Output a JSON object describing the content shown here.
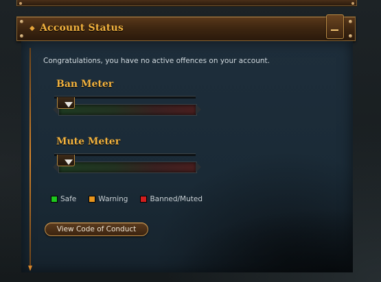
{
  "panel": {
    "title": "Account Status",
    "message": "Congratulations, you have no active offences on your account."
  },
  "meters": [
    {
      "title": "Ban Meter",
      "level": 0
    },
    {
      "title": "Mute Meter",
      "level": 0
    }
  ],
  "legend": [
    {
      "label": "Safe",
      "color": "#1ec81e"
    },
    {
      "label": "Warning",
      "color": "#e8961e"
    },
    {
      "label": "Banned/Muted",
      "color": "#d21e1e"
    }
  ],
  "actions": {
    "code_of_conduct": "View Code of Conduct"
  },
  "colors": {
    "accent": "#f2b23e",
    "panel_bg": "#1e2e3b",
    "header_bg": "#3f2711"
  }
}
